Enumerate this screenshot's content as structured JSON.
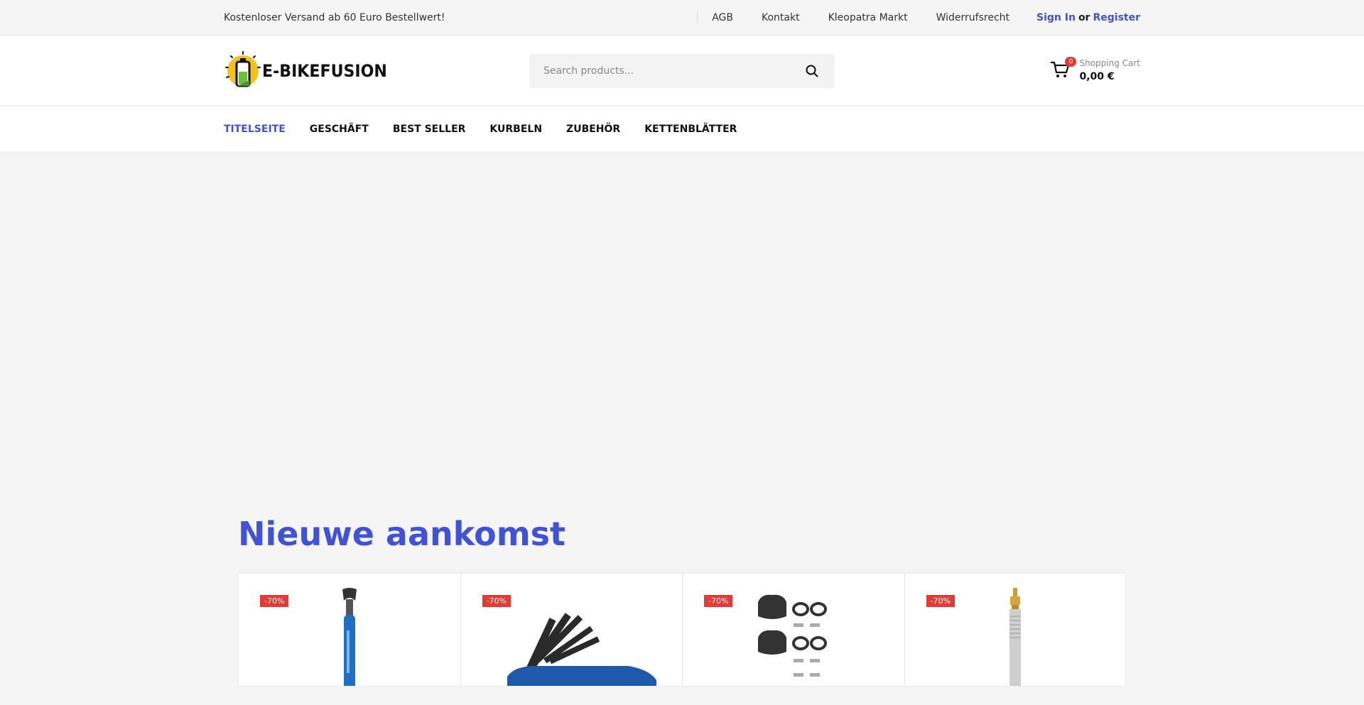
{
  "topbar": {
    "promo": "Kostenloser Versand ab 60 Euro Bestellwert!",
    "links": [
      "AGB",
      "Kontakt",
      "Kleopatra Markt",
      "Widerrufsrecht"
    ],
    "sign_in": "Sign In",
    "or": "or",
    "register": "Register"
  },
  "header": {
    "logo_text": "E-BIKEFUSION",
    "search_placeholder": "Search products...",
    "cart_count": "0",
    "cart_label": "Shopping Cart",
    "cart_total": "0,00 €"
  },
  "nav": {
    "items": [
      "TITELSEITE",
      "GESCHÄFT",
      "BEST SELLER",
      "KURBELN",
      "ZUBEHÖR",
      "KETTENBLÄTTER"
    ],
    "active_index": 0
  },
  "arrivals": {
    "title": "Nieuwe aankomst",
    "products": [
      {
        "badge": "-70%",
        "image": "pedal-wrench"
      },
      {
        "badge": "-70%",
        "image": "folding-hex-key-tool"
      },
      {
        "badge": "-70%",
        "image": "pedal-cleats"
      },
      {
        "badge": "-70%",
        "image": "presta-valve"
      }
    ]
  },
  "colors": {
    "accent": "#4052d6",
    "badge": "#e53935"
  }
}
